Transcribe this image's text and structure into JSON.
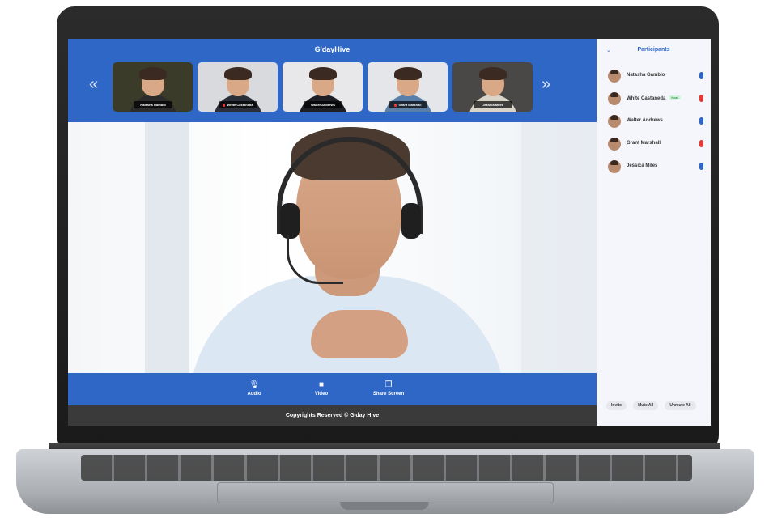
{
  "app": {
    "title": "G'dayHive"
  },
  "carousel": {
    "prev_icon": "chevron-double-left-icon",
    "next_icon": "chevron-double-right-icon",
    "thumbnails": [
      {
        "name": "Natasha Gamblo",
        "muted": false,
        "bg": "#3b3b2a",
        "shirt": "#2c2c2c"
      },
      {
        "name": "White Castaneda",
        "muted": true,
        "bg": "#d9dadd",
        "shirt": "#2b2f3a"
      },
      {
        "name": "Walter Andrews",
        "muted": false,
        "bg": "#e8e8ea",
        "shirt": "#1d1f24"
      },
      {
        "name": "Grant Marshall",
        "muted": true,
        "bg": "#e4e6ea",
        "shirt": "#5a7fa8"
      },
      {
        "name": "Jessica Miles",
        "muted": false,
        "bg": "#4a4846",
        "shirt": "#d9d3c8"
      }
    ]
  },
  "controls": {
    "audio_label": "Audio",
    "video_label": "Video",
    "share_label": "Share Screen",
    "hangup_icon": "phone-hangup-icon"
  },
  "footer": {
    "text": "Copyrights Reserved © G'day Hive"
  },
  "sidebar": {
    "title": "Participants",
    "participants": [
      {
        "name": "Natasha Gamblo",
        "host": false,
        "mic": "on"
      },
      {
        "name": "White Castaneda",
        "host": true,
        "host_label": "Host",
        "mic": "off"
      },
      {
        "name": "Walter Andrews",
        "host": false,
        "mic": "on"
      },
      {
        "name": "Grant Marshall",
        "host": false,
        "mic": "off"
      },
      {
        "name": "Jessica Miles",
        "host": false,
        "mic": "on"
      }
    ],
    "actions": {
      "invite": "Invite",
      "mute_all": "Mute All",
      "unmute_all": "Unmute All"
    }
  },
  "colors": {
    "primary": "#2f67c7",
    "danger": "#e53935",
    "footer": "#3a3a3a",
    "sidebar_bg": "#f4f6fb"
  }
}
